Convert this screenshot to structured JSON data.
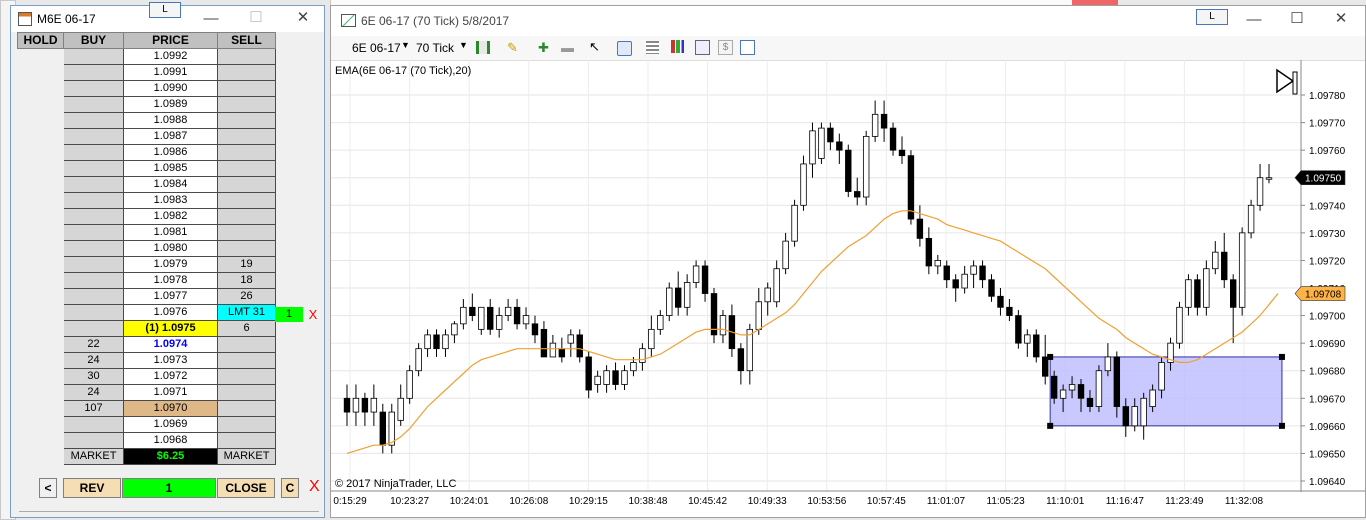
{
  "dom": {
    "title": "M6E 06-17",
    "tab_label": "L",
    "headers": {
      "hold": "HOLD",
      "buy": "BUY",
      "price": "PRICE",
      "sell": "SELL"
    },
    "rows": [
      {
        "buy": "",
        "price": "1.0992",
        "sell": ""
      },
      {
        "buy": "",
        "price": "1.0991",
        "sell": ""
      },
      {
        "buy": "",
        "price": "1.0990",
        "sell": ""
      },
      {
        "buy": "",
        "price": "1.0989",
        "sell": ""
      },
      {
        "buy": "",
        "price": "1.0988",
        "sell": ""
      },
      {
        "buy": "",
        "price": "1.0987",
        "sell": ""
      },
      {
        "buy": "",
        "price": "1.0986",
        "sell": ""
      },
      {
        "buy": "",
        "price": "1.0985",
        "sell": ""
      },
      {
        "buy": "",
        "price": "1.0984",
        "sell": ""
      },
      {
        "buy": "",
        "price": "1.0983",
        "sell": ""
      },
      {
        "buy": "",
        "price": "1.0982",
        "sell": ""
      },
      {
        "buy": "",
        "price": "1.0981",
        "sell": ""
      },
      {
        "buy": "",
        "price": "1.0980",
        "sell": ""
      },
      {
        "buy": "",
        "price": "1.0979",
        "sell": "19"
      },
      {
        "buy": "",
        "price": "1.0978",
        "sell": "18"
      },
      {
        "buy": "",
        "price": "1.0977",
        "sell": "26"
      },
      {
        "buy": "",
        "price": "1.0976",
        "sell": "LMT 31"
      },
      {
        "buy": "",
        "price": "(1) 1.0975",
        "sell": "6"
      },
      {
        "buy": "22",
        "price": "1.0974",
        "sell": ""
      },
      {
        "buy": "24",
        "price": "1.0973",
        "sell": ""
      },
      {
        "buy": "30",
        "price": "1.0972",
        "sell": ""
      },
      {
        "buy": "24",
        "price": "1.0971",
        "sell": ""
      },
      {
        "buy": "107",
        "price": "1.0970",
        "sell": ""
      },
      {
        "buy": "",
        "price": "1.0969",
        "sell": ""
      },
      {
        "buy": "",
        "price": "1.0968",
        "sell": ""
      }
    ],
    "market_row": {
      "buy": "MARKET",
      "pnl": "$6.25",
      "sell": "MARKET"
    },
    "order_qty": "1",
    "order_cancel": "X",
    "bottom": {
      "left": "<",
      "rev": "REV",
      "qty": "1",
      "close": "CLOSE",
      "c": "C",
      "x": "X"
    },
    "colors": {
      "lmt": "#00ffff",
      "qty_green": "#00ff00",
      "position_yellow": "#ffff00",
      "pnl_green": "#00ff00",
      "highlight_tan": "#deb887",
      "cancel_red": "#ff0000",
      "last_price_blue": "#0000ff"
    }
  },
  "chart": {
    "title": "6E 06-17 (70 Tick)  5/8/2017",
    "tab_label": "L",
    "toolbar": {
      "instrument": "6E 06-17",
      "interval": "70 Tick"
    },
    "indicator_label": "EMA(6E 06-17 (70 Tick),20)",
    "copyright": "© 2017 NinjaTrader, LLC",
    "price_badges": {
      "last": "1.09750",
      "ema": "1.09708"
    },
    "colors": {
      "ema": "#f0a030",
      "rect_fill": "#c0c0ff",
      "rect_stroke": "#3030a0",
      "ema_badge": "#ffb347"
    }
  },
  "chart_data": {
    "type": "candlestick",
    "xlabel": "",
    "ylabel": "",
    "ylim": [
      1.0964,
      1.0978
    ],
    "y_ticks": [
      "1.09640",
      "1.09650",
      "1.09660",
      "1.09670",
      "1.09680",
      "1.09690",
      "1.09700",
      "1.09710",
      "1.09720",
      "1.09730",
      "1.09740",
      "1.09750",
      "1.09760",
      "1.09770",
      "1.09780"
    ],
    "x_ticks": [
      "0:15:29",
      "10:23:27",
      "10:24:01",
      "10:26:08",
      "10:29:15",
      "10:38:48",
      "10:45:42",
      "10:49:33",
      "10:53:56",
      "10:57:45",
      "11:01:07",
      "11:05:23",
      "11:10:01",
      "11:16:47",
      "11:23:49",
      "11:32:08"
    ],
    "candles": [
      [
        1.0967,
        1.09665,
        1.09675,
        1.0966
      ],
      [
        1.09665,
        1.0967,
        1.09675,
        1.0966
      ],
      [
        1.0967,
        1.09665,
        1.09672,
        1.0966
      ],
      [
        1.09665,
        1.0967,
        1.09675,
        1.0966
      ],
      [
        1.09665,
        1.09653,
        1.09668,
        1.0965
      ],
      [
        1.09653,
        1.09665,
        1.09668,
        1.0965
      ],
      [
        1.09662,
        1.0967,
        1.09675,
        1.0966
      ],
      [
        1.0967,
        1.0968,
        1.09682,
        1.09668
      ],
      [
        1.0968,
        1.09688,
        1.0969,
        1.09678
      ],
      [
        1.09688,
        1.09693,
        1.09695,
        1.09685
      ],
      [
        1.09693,
        1.09688,
        1.09695,
        1.09685
      ],
      [
        1.09688,
        1.09693,
        1.09695,
        1.09685
      ],
      [
        1.09693,
        1.09697,
        1.09698,
        1.0969
      ],
      [
        1.09697,
        1.09703,
        1.09706,
        1.09695
      ],
      [
        1.09703,
        1.097,
        1.09708,
        1.09698
      ],
      [
        1.09695,
        1.09703,
        1.09703,
        1.09693
      ],
      [
        1.09703,
        1.09695,
        1.09706,
        1.09693
      ],
      [
        1.09695,
        1.097,
        1.09703,
        1.09692
      ],
      [
        1.097,
        1.09703,
        1.09706,
        1.09698
      ],
      [
        1.09703,
        1.09697,
        1.09706,
        1.09695
      ],
      [
        1.09697,
        1.097,
        1.09703,
        1.09695
      ],
      [
        1.09697,
        1.09693,
        1.097,
        1.0969
      ],
      [
        1.09695,
        1.09685,
        1.09698,
        1.09685
      ],
      [
        1.09685,
        1.0969,
        1.09693,
        1.09685
      ],
      [
        1.09688,
        1.09685,
        1.09692,
        1.09683
      ],
      [
        1.0969,
        1.09693,
        1.09695,
        1.09685
      ],
      [
        1.09693,
        1.09685,
        1.09695,
        1.09683
      ],
      [
        1.09685,
        1.09673,
        1.09687,
        1.0967
      ],
      [
        1.09675,
        1.09678,
        1.0968,
        1.09672
      ],
      [
        1.09675,
        1.0968,
        1.09682,
        1.09672
      ],
      [
        1.0968,
        1.09675,
        1.09683,
        1.09673
      ],
      [
        1.09675,
        1.0968,
        1.09682,
        1.09673
      ],
      [
        1.0968,
        1.09683,
        1.09685,
        1.09678
      ],
      [
        1.09683,
        1.09688,
        1.0969,
        1.0968
      ],
      [
        1.09688,
        1.09695,
        1.097,
        1.09685
      ],
      [
        1.09695,
        1.097,
        1.09702,
        1.09693
      ],
      [
        1.097,
        1.0971,
        1.09712,
        1.09698
      ],
      [
        1.0971,
        1.09703,
        1.09716,
        1.097
      ],
      [
        1.09703,
        1.09712,
        1.09715,
        1.097
      ],
      [
        1.09712,
        1.09718,
        1.0972,
        1.0971
      ],
      [
        1.09718,
        1.09708,
        1.0972,
        1.09705
      ],
      [
        1.09708,
        1.09693,
        1.0971,
        1.0969
      ],
      [
        1.09693,
        1.097,
        1.09702,
        1.0969
      ],
      [
        1.097,
        1.09688,
        1.09704,
        1.09685
      ],
      [
        1.09688,
        1.0968,
        1.0969,
        1.09675
      ],
      [
        1.0968,
        1.09695,
        1.09697,
        1.09675
      ],
      [
        1.09695,
        1.09705,
        1.0971,
        1.09693
      ],
      [
        1.09705,
        1.0971,
        1.09712,
        1.097
      ],
      [
        1.09705,
        1.09717,
        1.0972,
        1.09703
      ],
      [
        1.09717,
        1.09727,
        1.0973,
        1.09715
      ],
      [
        1.09727,
        1.0974,
        1.09742,
        1.09725
      ],
      [
        1.0974,
        1.09755,
        1.09758,
        1.09738
      ],
      [
        1.09755,
        1.09767,
        1.0977,
        1.0975
      ],
      [
        1.09757,
        1.09768,
        1.0977,
        1.09755
      ],
      [
        1.09768,
        1.09763,
        1.0977,
        1.0976
      ],
      [
        1.09763,
        1.0976,
        1.09766,
        1.09755
      ],
      [
        1.0976,
        1.09745,
        1.09762,
        1.09743
      ],
      [
        1.09745,
        1.09743,
        1.0975,
        1.0974
      ],
      [
        1.09743,
        1.09765,
        1.09767,
        1.0974
      ],
      [
        1.09765,
        1.09773,
        1.09778,
        1.09763
      ],
      [
        1.09773,
        1.09768,
        1.09778,
        1.09763
      ],
      [
        1.09768,
        1.0976,
        1.0977,
        1.09758
      ],
      [
        1.0976,
        1.09758,
        1.09765,
        1.09755
      ],
      [
        1.09758,
        1.09735,
        1.0976,
        1.09733
      ],
      [
        1.09735,
        1.09728,
        1.0974,
        1.09725
      ],
      [
        1.09728,
        1.09718,
        1.09732,
        1.09715
      ],
      [
        1.09718,
        1.0972,
        1.09722,
        1.09715
      ],
      [
        1.09718,
        1.09713,
        1.0972,
        1.0971
      ],
      [
        1.09713,
        1.0971,
        1.09715,
        1.09705
      ],
      [
        1.0971,
        1.09715,
        1.09718,
        1.09708
      ],
      [
        1.09715,
        1.09718,
        1.0972,
        1.0971
      ],
      [
        1.09718,
        1.09713,
        1.0972,
        1.0971
      ],
      [
        1.09713,
        1.09707,
        1.09715,
        1.09705
      ],
      [
        1.09707,
        1.09703,
        1.0971,
        1.097
      ],
      [
        1.09703,
        1.097,
        1.09706,
        1.09698
      ],
      [
        1.097,
        1.0969,
        1.09702,
        1.09688
      ],
      [
        1.0969,
        1.09693,
        1.09695,
        1.09685
      ],
      [
        1.09693,
        1.09685,
        1.09695,
        1.09683
      ],
      [
        1.09685,
        1.09678,
        1.09693,
        1.09675
      ],
      [
        1.09678,
        1.0967,
        1.0968,
        1.09668
      ],
      [
        1.0967,
        1.09673,
        1.09675,
        1.09665
      ],
      [
        1.09673,
        1.09675,
        1.09678,
        1.0967
      ],
      [
        1.09675,
        1.0967,
        1.09677,
        1.09665
      ],
      [
        1.0967,
        1.09667,
        1.09673,
        1.09665
      ],
      [
        1.09667,
        1.0968,
        1.09682,
        1.09665
      ],
      [
        1.0968,
        1.09685,
        1.0969,
        1.09678
      ],
      [
        1.09685,
        1.09667,
        1.09687,
        1.09663
      ],
      [
        1.09667,
        1.0966,
        1.0967,
        1.09656
      ],
      [
        1.0966,
        1.09667,
        1.0967,
        1.09658
      ],
      [
        1.0966,
        1.0967,
        1.09672,
        1.09655
      ],
      [
        1.09667,
        1.09673,
        1.09675,
        1.09665
      ],
      [
        1.09673,
        1.09683,
        1.09685,
        1.0967
      ],
      [
        1.09683,
        1.0969,
        1.09692,
        1.0968
      ],
      [
        1.0969,
        1.09703,
        1.09705,
        1.09688
      ],
      [
        1.09703,
        1.09713,
        1.09715,
        1.097
      ],
      [
        1.09713,
        1.09703,
        1.09715,
        1.097
      ],
      [
        1.09703,
        1.09717,
        1.0972,
        1.097
      ],
      [
        1.09717,
        1.09723,
        1.09727,
        1.09715
      ],
      [
        1.09723,
        1.09713,
        1.0973,
        1.0971
      ],
      [
        1.09713,
        1.09703,
        1.09715,
        1.0969
      ],
      [
        1.09703,
        1.0973,
        1.09732,
        1.097
      ],
      [
        1.0973,
        1.0974,
        1.09742,
        1.09728
      ],
      [
        1.0974,
        1.0975,
        1.09755,
        1.09738
      ],
      [
        1.0975,
        1.0975,
        1.09755,
        1.09748
      ]
    ],
    "ema": [
      1.0965,
      1.09651,
      1.09652,
      1.09653,
      1.09653,
      1.09654,
      1.09656,
      1.09659,
      1.09663,
      1.09667,
      1.0967,
      1.09673,
      1.09676,
      1.09679,
      1.09682,
      1.09684,
      1.09685,
      1.09686,
      1.09687,
      1.09688,
      1.09688,
      1.09688,
      1.09688,
      1.09688,
      1.09688,
      1.09688,
      1.09688,
      1.09687,
      1.09686,
      1.09685,
      1.09684,
      1.09684,
      1.09684,
      1.09684,
      1.09685,
      1.09686,
      1.09688,
      1.0969,
      1.09692,
      1.09694,
      1.09695,
      1.09695,
      1.09695,
      1.09694,
      1.09693,
      1.09693,
      1.09695,
      1.09697,
      1.09699,
      1.09701,
      1.09704,
      1.09708,
      1.09712,
      1.09716,
      1.09719,
      1.09722,
      1.09725,
      1.09727,
      1.09729,
      1.09732,
      1.09735,
      1.09737,
      1.09738,
      1.09738,
      1.09737,
      1.09736,
      1.09735,
      1.09733,
      1.09732,
      1.09731,
      1.0973,
      1.09729,
      1.09728,
      1.09727,
      1.09725,
      1.09723,
      1.09721,
      1.09719,
      1.09717,
      1.09714,
      1.09711,
      1.09708,
      1.09705,
      1.09702,
      1.09699,
      1.09697,
      1.09695,
      1.09692,
      1.0969,
      1.09688,
      1.09686,
      1.09685,
      1.09684,
      1.09683,
      1.09683,
      1.09684,
      1.09686,
      1.09688,
      1.0969,
      1.09692,
      1.09694,
      1.09697,
      1.097,
      1.09704,
      1.09708
    ],
    "rectangle": {
      "price_top": 1.09685,
      "price_bottom": 1.0966,
      "bar_start": 79,
      "bar_end": 104
    }
  }
}
